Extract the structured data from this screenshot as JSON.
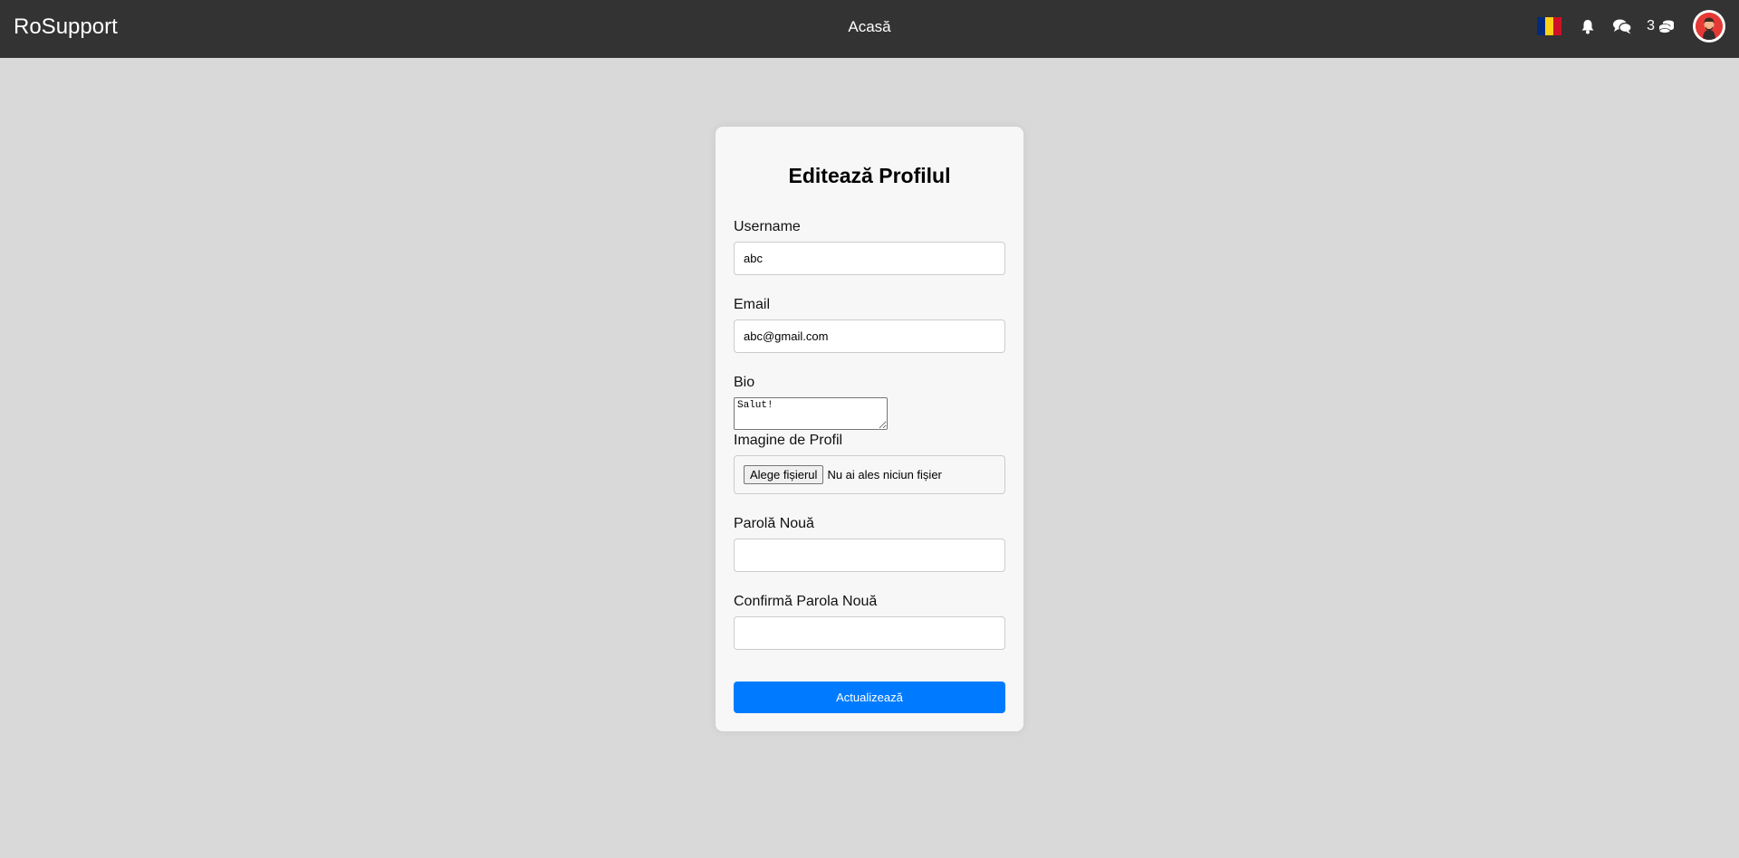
{
  "navbar": {
    "brand": "RoSupport",
    "home_link": "Acasă",
    "language_flag": "romania-flag",
    "flag_colors": [
      "#002B7F",
      "#FCD116",
      "#CE1126"
    ],
    "notifications_icon": "bell-icon",
    "messages_icon": "chat-icon",
    "coins_count": "3",
    "coins_icon": "coins-icon",
    "avatar_icon": "user-avatar"
  },
  "form": {
    "title": "Editează Profilul",
    "username": {
      "label": "Username",
      "value": "abc"
    },
    "email": {
      "label": "Email",
      "value": "abc@gmail.com"
    },
    "bio": {
      "label": "Bio",
      "value": "Salut!"
    },
    "profile_image": {
      "label": "Imagine de Profil",
      "button_label": "Alege fișierul",
      "status": "Nu ai ales niciun fișier"
    },
    "new_password": {
      "label": "Parolă Nouă",
      "value": ""
    },
    "confirm_password": {
      "label": "Confirmă Parola Nouă",
      "value": ""
    },
    "submit_label": "Actualizează"
  },
  "colors": {
    "navbar_bg": "#333333",
    "page_bg": "#d9d9d9",
    "card_bg": "#f7f7f7",
    "primary_button": "#007bff"
  }
}
